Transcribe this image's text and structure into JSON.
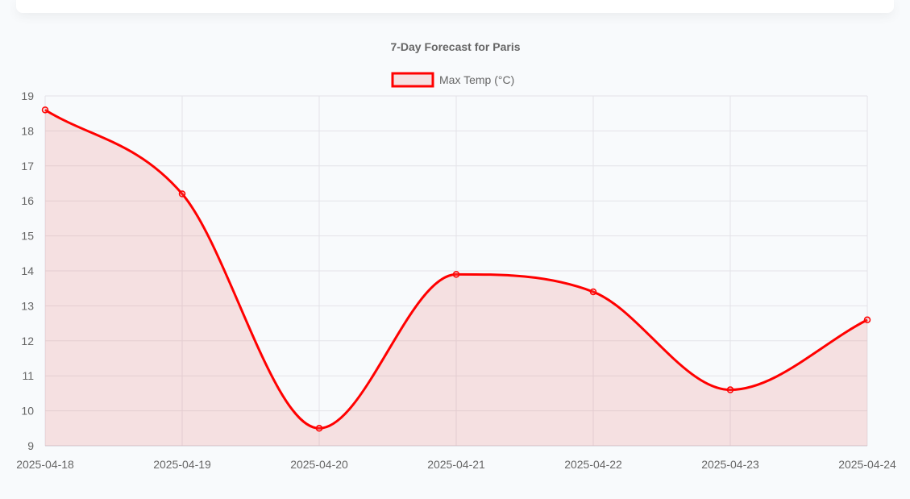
{
  "colors": {
    "line": "#ff0000",
    "fill": "rgba(236, 120, 120, 0.2)",
    "grid": "#e3e3e8",
    "text": "#666666",
    "title": "#666666"
  },
  "chart_data": {
    "type": "line",
    "title": "7-Day Forecast for Paris",
    "categories": [
      "2025-04-18",
      "2025-04-19",
      "2025-04-20",
      "2025-04-21",
      "2025-04-22",
      "2025-04-23",
      "2025-04-24"
    ],
    "series": [
      {
        "name": "Max Temp (°C)",
        "values": [
          18.6,
          16.2,
          9.5,
          13.9,
          13.4,
          10.6,
          12.6
        ]
      }
    ],
    "ylim": [
      9,
      19
    ],
    "yticks": [
      9,
      10,
      11,
      12,
      13,
      14,
      15,
      16,
      17,
      18,
      19
    ],
    "grid": true,
    "legend": "top",
    "fill": true,
    "smooth": true
  }
}
